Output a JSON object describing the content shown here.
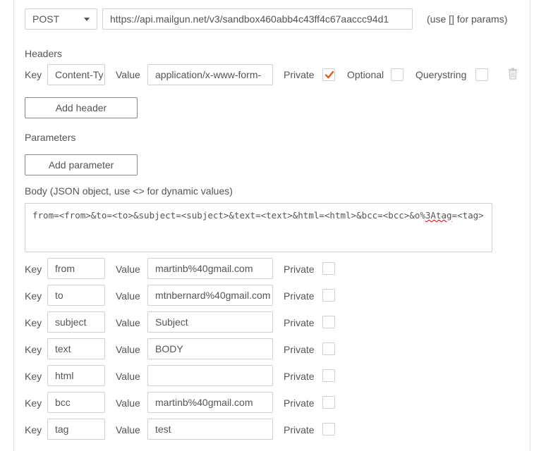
{
  "request": {
    "method": "POST",
    "url": "https://api.mailgun.net/v3/sandbox460abb4c43ff4c67aaccc94d1",
    "url_hint": "(use [] for params)"
  },
  "headers_section": {
    "title": "Headers",
    "key_label": "Key",
    "value_label": "Value",
    "key": "Content-Ty",
    "value": "application/x-www-form-",
    "private_label": "Private",
    "private_checked": true,
    "optional_label": "Optional",
    "optional_checked": false,
    "querystring_label": "Querystring",
    "querystring_checked": false,
    "add_button": "Add header",
    "delete_icon": "trash-icon"
  },
  "parameters_section": {
    "title": "Parameters",
    "add_button": "Add parameter"
  },
  "body_section": {
    "title": "Body (JSON object, use <> for dynamic values)",
    "text_before": "from=<from>&to=<to>&subject=<subject>&text=<text>&html=<html>&bcc=<bcc>&o%",
    "text_misspelled": "3Atag",
    "text_after": "=<tag>",
    "key_label": "Key",
    "value_label": "Value",
    "private_label": "Private",
    "rows": [
      {
        "key": "from",
        "value": "martinb%40gmail.com",
        "private": false
      },
      {
        "key": "to",
        "value": "mtnbernard%40gmail.com",
        "private": false
      },
      {
        "key": "subject",
        "value": "Subject",
        "private": false
      },
      {
        "key": "text",
        "value": "BODY",
        "private": false
      },
      {
        "key": "html",
        "value": "",
        "private": false
      },
      {
        "key": "bcc",
        "value": "martinb%40gmail.com",
        "private": false
      },
      {
        "key": "tag",
        "value": "test",
        "private": false
      }
    ]
  },
  "colors": {
    "accent_check": "#e35a26",
    "border": "#cfcfcf",
    "text": "#555555"
  }
}
